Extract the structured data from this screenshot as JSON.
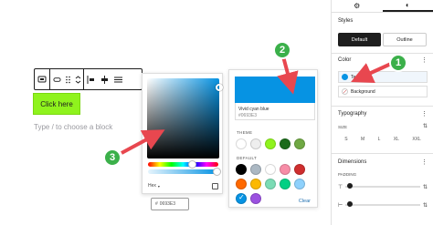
{
  "editor": {
    "button_label": "Click here",
    "block_hint": "Type / to choose a block"
  },
  "picker": {
    "format_label": "Hex",
    "hex_value": "0693E3"
  },
  "palette": {
    "selected_name": "Vivid cyan blue",
    "selected_hex": "#0693E3",
    "selected_color": "#0693e3",
    "theme_label": "THEME",
    "theme_colors": [
      "#ffffff",
      "#eeeeee",
      "#8ff31d",
      "#1a6b1a",
      "#6fa843"
    ],
    "default_label": "DEFAULT",
    "default_row1": [
      "#000000",
      "#abb8c3",
      "#ffffff",
      "#f78da7",
      "#cf2e2e"
    ],
    "default_row2": [
      "#ff6900",
      "#fcb900",
      "#7bdcb5",
      "#00d084",
      "#8ed1fc"
    ],
    "default_row3": [
      "#0693e3",
      "#9b51e0"
    ],
    "clear_label": "Clear"
  },
  "sidebar": {
    "styles_title": "Styles",
    "style_default": "Default",
    "style_outline": "Outline",
    "color_title": "Color",
    "color_text": "Text",
    "color_text_swatch": "#0693e3",
    "color_background": "Background",
    "typography_title": "Typography",
    "size_label": "SIZE",
    "sizes": [
      "S",
      "M",
      "L",
      "XL",
      "XXL"
    ],
    "dimensions_title": "Dimensions",
    "padding_label": "PADDING"
  },
  "annotations": {
    "badge_1": "1",
    "badge_2": "2",
    "badge_3": "3",
    "arrow_color": "#e8474f",
    "badge_color": "#3bb04a"
  }
}
